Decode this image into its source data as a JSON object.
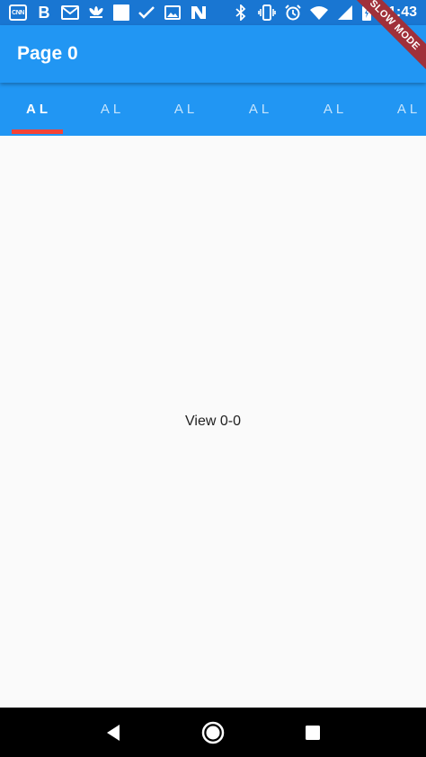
{
  "status_bar": {
    "time": "11:43",
    "left_icons": [
      "cnn-icon",
      "b-icon",
      "gmail-icon",
      "nbc-icon",
      "square-icon",
      "check-icon",
      "image-icon",
      "n-icon"
    ],
    "right_icons": [
      "bluetooth-icon",
      "vibrate-icon",
      "alarm-icon",
      "wifi-icon",
      "signal-icon",
      "battery-icon"
    ],
    "cnn_label": "CNN",
    "b_label": "B"
  },
  "app_bar": {
    "title": "Page 0"
  },
  "tabs": [
    {
      "label": "AL",
      "active": true
    },
    {
      "label": "AL",
      "active": false
    },
    {
      "label": "AL",
      "active": false
    },
    {
      "label": "AL",
      "active": false
    },
    {
      "label": "AL",
      "active": false
    },
    {
      "label": "AL",
      "active": false
    }
  ],
  "content": {
    "text": "View 0-0"
  },
  "banner": {
    "text": "SLOW MODE"
  },
  "nav_bar": {
    "buttons": [
      "back-icon",
      "home-icon",
      "recents-icon"
    ]
  },
  "colors": {
    "status_bar": "#1976D2",
    "primary": "#2196F3",
    "indicator": "#F44336",
    "banner": "#A0303A",
    "background": "#FAFAFA"
  }
}
